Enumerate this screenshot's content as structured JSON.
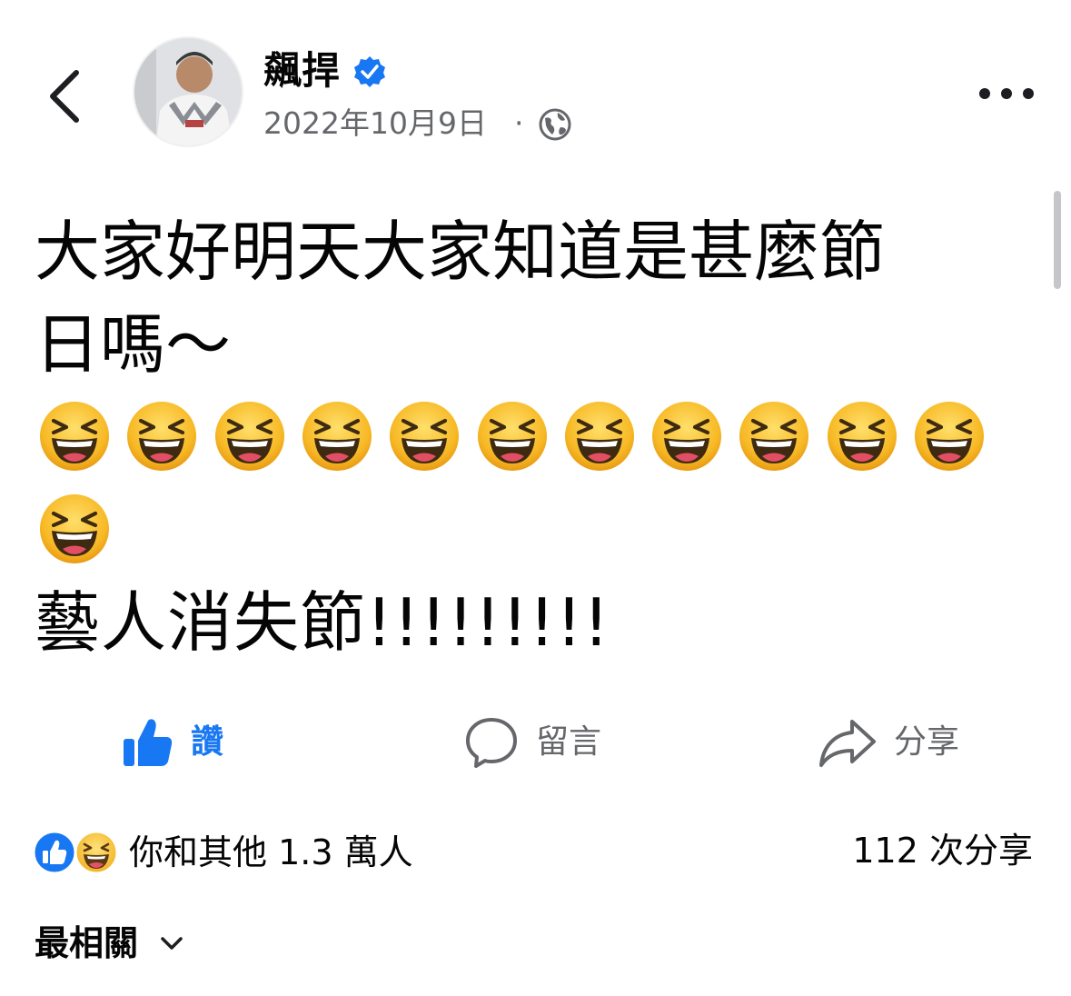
{
  "post_header": {
    "author_name": "飆捍",
    "verified_icon": "verified-badge-icon",
    "date": "2022年10月9日",
    "separator": "·",
    "audience_icon": "globe-icon"
  },
  "post": {
    "line1": "大家好明天大家知道是甚麼節",
    "line2": "日嗎～",
    "emoji_name": "grinning-squinting-face",
    "emoji_count": 12,
    "line3": "藝人消失節!!!!!!!!!"
  },
  "actions": {
    "like_label": "讚",
    "comment_label": "留言",
    "share_label": "分享"
  },
  "stats": {
    "reactions_text": "你和其他 1.3 萬人",
    "shares_text": "112 次分享"
  },
  "comments": {
    "sort_label": "最相關"
  },
  "colors": {
    "accent": "#1877f2",
    "secondary_text": "#65676b",
    "primary_text": "#050505"
  }
}
